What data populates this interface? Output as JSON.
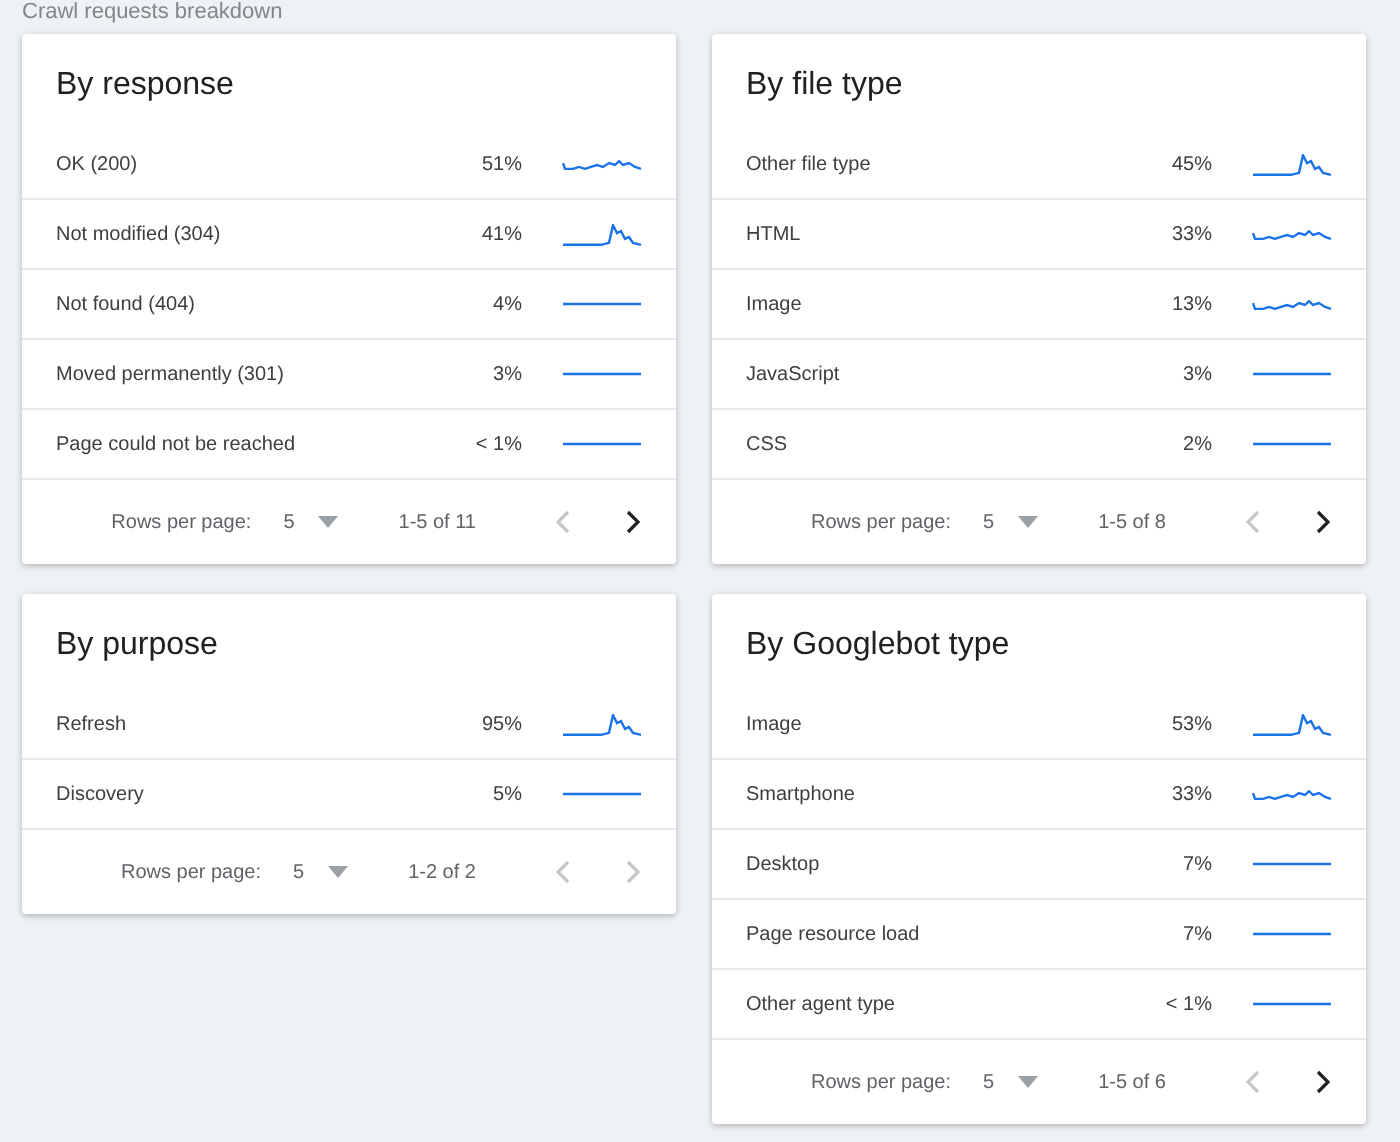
{
  "header": {
    "title": "Crawl requests breakdown"
  },
  "columns": [
    [
      {
        "title": "By response",
        "rows": [
          {
            "label": "OK (200)",
            "share": "51%",
            "trend": {
              "kind": "wavy"
            }
          },
          {
            "label": "Not modified (304)",
            "share": "41%",
            "trend": {
              "kind": "spike"
            }
          },
          {
            "label": "Not found (404)",
            "share": "4%",
            "trend": {
              "kind": "flat"
            }
          },
          {
            "label": "Moved permanently (301)",
            "share": "3%",
            "trend": {
              "kind": "flat"
            }
          },
          {
            "label": "Page could not be reached",
            "share": "< 1%",
            "trend": {
              "kind": "flat"
            }
          }
        ],
        "footer": {
          "rows_label": "Rows per page:",
          "rows_value": "5",
          "range": "1-5 of 11",
          "prev": {
            "disabled": true
          },
          "next": {
            "disabled": false
          }
        }
      },
      {
        "title": "By purpose",
        "rows": [
          {
            "label": "Refresh",
            "share": "95%",
            "trend": {
              "kind": "spike"
            }
          },
          {
            "label": "Discovery",
            "share": "5%",
            "trend": {
              "kind": "flat"
            }
          }
        ],
        "footer": {
          "rows_label": "Rows per page:",
          "rows_value": "5",
          "range": "1-2 of 2",
          "prev": {
            "disabled": true
          },
          "next": {
            "disabled": true
          }
        }
      }
    ],
    [
      {
        "title": "By file type",
        "rows": [
          {
            "label": "Other file type",
            "share": "45%",
            "trend": {
              "kind": "spike"
            }
          },
          {
            "label": "HTML",
            "share": "33%",
            "trend": {
              "kind": "wavy"
            }
          },
          {
            "label": "Image",
            "share": "13%",
            "trend": {
              "kind": "wavy"
            }
          },
          {
            "label": "JavaScript",
            "share": "3%",
            "trend": {
              "kind": "flat"
            }
          },
          {
            "label": "CSS",
            "share": "2%",
            "trend": {
              "kind": "flat"
            }
          }
        ],
        "footer": {
          "rows_label": "Rows per page:",
          "rows_value": "5",
          "range": "1-5 of 8",
          "prev": {
            "disabled": true
          },
          "next": {
            "disabled": false
          }
        }
      },
      {
        "title": "By Googlebot type",
        "rows": [
          {
            "label": "Image",
            "share": "53%",
            "trend": {
              "kind": "spike"
            }
          },
          {
            "label": "Smartphone",
            "share": "33%",
            "trend": {
              "kind": "wavy"
            }
          },
          {
            "label": "Desktop",
            "share": "7%",
            "trend": {
              "kind": "flat"
            }
          },
          {
            "label": "Page resource load",
            "share": "7%",
            "trend": {
              "kind": "flat"
            }
          },
          {
            "label": "Other agent type",
            "share": "< 1%",
            "trend": {
              "kind": "flat"
            }
          }
        ],
        "footer": {
          "rows_label": "Rows per page:",
          "rows_value": "5",
          "range": "1-5 of 6",
          "prev": {
            "disabled": true
          },
          "next": {
            "disabled": false
          }
        }
      }
    ]
  ]
}
